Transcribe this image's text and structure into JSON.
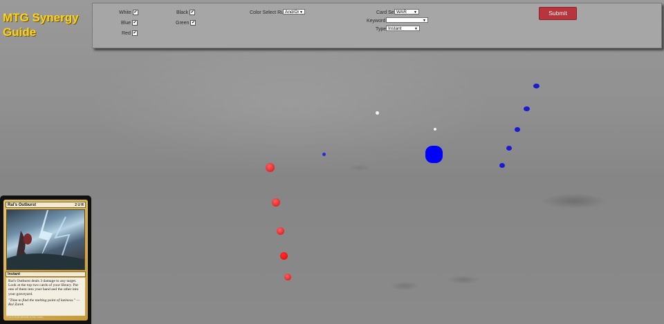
{
  "app": {
    "title": "MTG Synergy Guide"
  },
  "filters": {
    "colors": [
      {
        "label": "White",
        "checked": true
      },
      {
        "label": "Blue",
        "checked": true
      },
      {
        "label": "Red",
        "checked": true
      },
      {
        "label": "Black",
        "checked": true
      },
      {
        "label": "Green",
        "checked": true
      }
    ],
    "check_glyph": "✔",
    "color_rule": {
      "label": "Color Select Rule",
      "value": "And/Or"
    },
    "card_set": {
      "label": "Card Set",
      "value": "WAR"
    },
    "keyword": {
      "label": "Keyword",
      "value": ""
    },
    "type": {
      "label": "Type",
      "value": "Instant"
    },
    "submit_label": "Submit"
  },
  "colors": {
    "accent_submit": "#b8353d",
    "title_yellow": "#ffd21a",
    "blue_node": "#0000ff",
    "red_node": "#ff0000",
    "white_node": "#ffffff"
  },
  "card": {
    "name": "Ral's Outburst",
    "mana_cost": "2 U R",
    "type_line": "Instant",
    "rules_text": "Ral's Outburst deals 3 damage to any target. Look at the top two cards of your library. Put one of them into your hand and the other into your graveyard.",
    "flavor_text": "\"Time to find the melting point of laziness.\" —Ral Zarek",
    "footer": "™ & © 2019 Wizards of the Coast"
  }
}
